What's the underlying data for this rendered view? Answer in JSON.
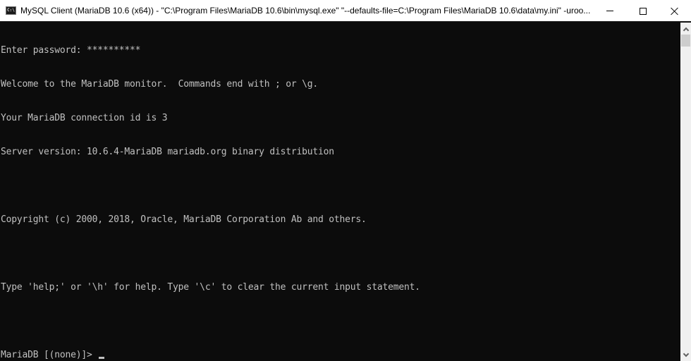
{
  "window": {
    "title": "MySQL Client (MariaDB 10.6 (x64)) - \"C:\\Program Files\\MariaDB 10.6\\bin\\mysql.exe\"  \"--defaults-file=C:\\Program Files\\MariaDB 10.6\\data\\my.ini\" -uroo...",
    "icon": "console-app-icon",
    "controls": {
      "minimize": "minimize-icon",
      "maximize": "maximize-icon",
      "close": "close-icon"
    }
  },
  "console": {
    "lines": [
      "Enter password: **********",
      "Welcome to the MariaDB monitor.  Commands end with ; or \\g.",
      "Your MariaDB connection id is 3",
      "Server version: 10.6.4-MariaDB mariadb.org binary distribution",
      "",
      "Copyright (c) 2000, 2018, Oracle, MariaDB Corporation Ab and others.",
      "",
      "Type 'help;' or '\\h' for help. Type '\\c' to clear the current input statement.",
      ""
    ],
    "prompt": "MariaDB [(none)]> ",
    "input": ""
  },
  "colors": {
    "console_bg": "#0c0c0c",
    "console_fg": "#c0c0c0",
    "titlebar_bg": "#ffffff"
  }
}
